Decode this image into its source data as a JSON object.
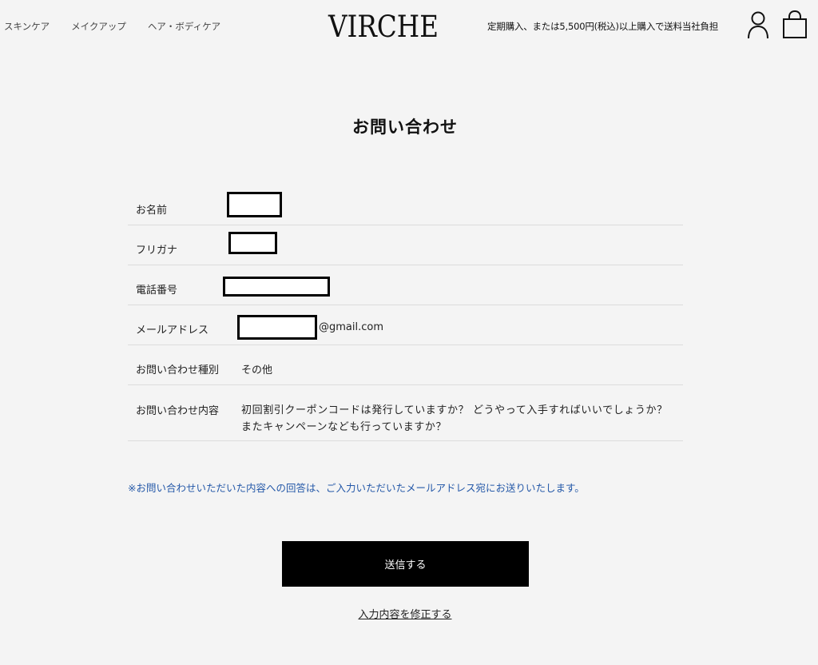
{
  "header": {
    "nav": [
      "スキンケア",
      "メイクアップ",
      "ヘア・ボディケア"
    ],
    "logo": "VIRCHE",
    "shipping_note": "定期購入、または5,500円(税込)以上購入で送料当社負担",
    "icons": [
      "user-icon",
      "shopping-bag-icon"
    ]
  },
  "page": {
    "title": "お問い合わせ"
  },
  "form": {
    "rows": [
      {
        "label": "お名前",
        "value": ""
      },
      {
        "label": "フリガナ",
        "value": ""
      },
      {
        "label": "電話番号",
        "value": ""
      },
      {
        "label": "メールアドレス",
        "value": "@gmail.com"
      },
      {
        "label": "お問い合わせ種別",
        "value": "その他"
      },
      {
        "label": "お問い合わせ内容",
        "value": "初回割引クーポンコードは発行していますか？ どうやって入手すればいいでしょうか？ またキャンペーンなども行っていますか？"
      }
    ]
  },
  "notice": "※お問い合わせいただいた内容への回答は、ご入力いただいたメールアドレス宛にお送りいたします。",
  "actions": {
    "submit_label": "送信する",
    "edit_label": "入力内容を修正する"
  },
  "colors": {
    "notice": "#2458a8",
    "button_bg": "#000000",
    "background": "#f4f4f4"
  }
}
